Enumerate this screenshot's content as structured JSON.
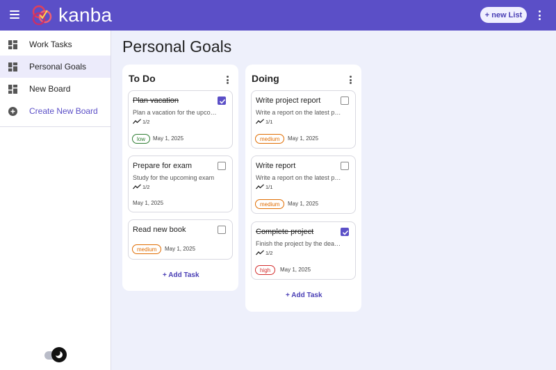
{
  "app": {
    "brand": "kanba",
    "new_list_label": "+ new List"
  },
  "sidebar": {
    "items": [
      {
        "label": "Work Tasks"
      },
      {
        "label": "Personal Goals"
      },
      {
        "label": "New Board"
      },
      {
        "label": "Create New Board"
      }
    ]
  },
  "board": {
    "title": "Personal Goals"
  },
  "columns": [
    {
      "title": "To Do",
      "add_label": "+ Add Task",
      "cards": [
        {
          "title": "Plan vacation",
          "desc": "Plan a vacation for the upcoming holidays",
          "subtasks": "1/2",
          "tag": "low",
          "date": "May 1, 2025",
          "done": true
        },
        {
          "title": "Prepare for exam",
          "desc": "Study for the upcoming exam",
          "subtasks": "1/2",
          "date": "May 1, 2025",
          "done": false
        },
        {
          "title": "Read new book",
          "tag": "medium",
          "date": "May 1, 2025",
          "done": false
        }
      ]
    },
    {
      "title": "Doing",
      "add_label": "+ Add Task",
      "cards": [
        {
          "title": "Write project report",
          "desc": "Write a report on the latest project",
          "subtasks": "1/1",
          "tag": "medium",
          "date": "May 1, 2025",
          "done": false
        },
        {
          "title": "Write report",
          "desc": "Write a report on the latest project",
          "subtasks": "1/1",
          "tag": "medium",
          "date": "May 1, 2025",
          "done": false
        },
        {
          "title": "Complete project",
          "desc": "Finish the project by the deadline",
          "subtasks": "1/2",
          "tag": "high",
          "date": "May 1, 2025",
          "done": true
        }
      ]
    }
  ],
  "colors": {
    "primary": "#5b4fc7",
    "background": "#eef0fb",
    "low": "#2e7d32",
    "medium": "#e06c00",
    "high": "#d32f2f"
  },
  "icons": {
    "menu": "hamburger-icon",
    "board": "dashboard-icon",
    "create": "add-circle-icon",
    "more": "more-vert-icon",
    "subtasks": "trending-icon",
    "theme": "dark-mode-toggle"
  }
}
